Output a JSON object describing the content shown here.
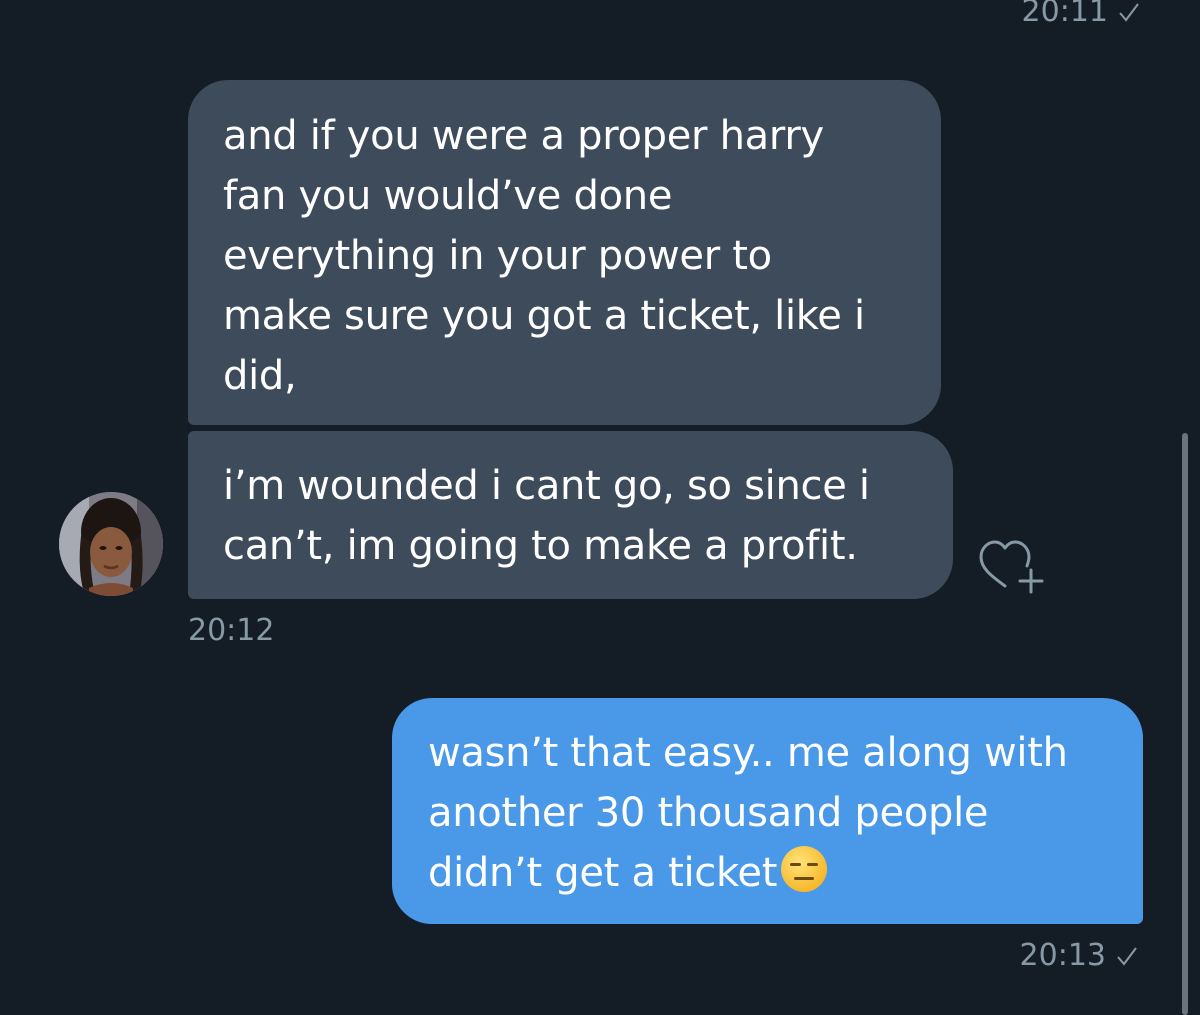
{
  "conversation": {
    "top_timestamp": "20:11",
    "received": {
      "messages": [
        {
          "lines": [
            "and if you were a proper harry",
            "fan you would’ve done",
            "everything in your power to",
            "make sure you got a ticket, like i",
            "did,"
          ]
        },
        {
          "lines": [
            "i’m wounded i cant go, so since i",
            "can’t, im going to make a profit."
          ]
        }
      ],
      "timestamp": "20:12",
      "avatar_icon": "profile-photo",
      "reaction_icon": "heart-plus-icon"
    },
    "sent": {
      "lines": [
        "wasn’t that easy.. me along with",
        "another 30 thousand people",
        "didn’t get a ticket"
      ],
      "emoji": "expressionless-face-emoji",
      "timestamp": "20:13",
      "status_icon": "check-icon"
    }
  },
  "colors": {
    "background": "#141d26",
    "received_bubble": "#3d4b5a",
    "sent_bubble": "#4a99e9",
    "timestamp_text": "#8899a6"
  }
}
